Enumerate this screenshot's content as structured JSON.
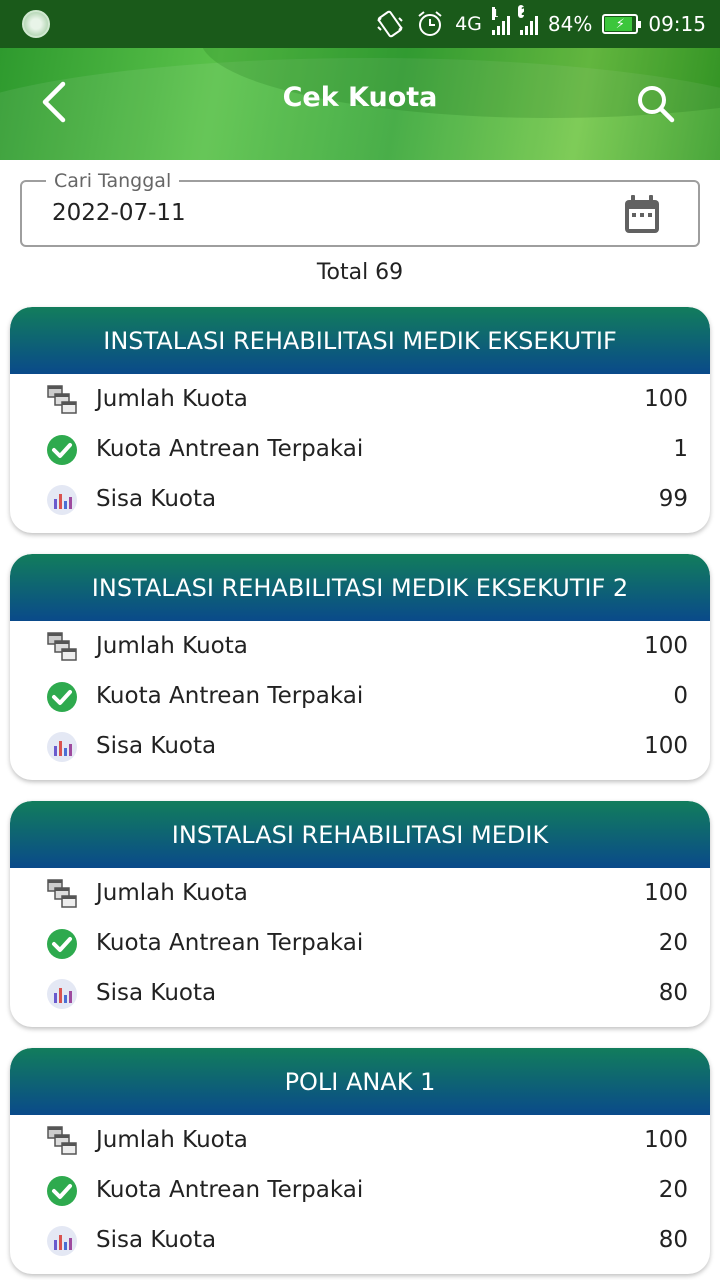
{
  "status": {
    "network": "4G",
    "sim1": "1",
    "sim2": "2",
    "battery": "84%",
    "time": "09:15"
  },
  "appbar": {
    "title": "Cek Kuota"
  },
  "date_field": {
    "label": "Cari Tanggal",
    "value": "2022-07-11"
  },
  "total": "Total 69",
  "cards": [
    {
      "title": "INSTALASI REHABILITASI MEDIK EKSEKUTIF",
      "rows": [
        {
          "label": "Jumlah Kuota",
          "value": "100"
        },
        {
          "label": "Kuota Antrean Terpakai",
          "value": "1"
        },
        {
          "label": "Sisa Kuota",
          "value": "99"
        }
      ]
    },
    {
      "title": "INSTALASI REHABILITASI MEDIK EKSEKUTIF 2",
      "rows": [
        {
          "label": "Jumlah Kuota",
          "value": "100"
        },
        {
          "label": "Kuota Antrean Terpakai",
          "value": "0"
        },
        {
          "label": "Sisa Kuota",
          "value": "100"
        }
      ]
    },
    {
      "title": "INSTALASI REHABILITASI MEDIK",
      "rows": [
        {
          "label": "Jumlah Kuota",
          "value": "100"
        },
        {
          "label": "Kuota Antrean Terpakai",
          "value": "20"
        },
        {
          "label": "Sisa Kuota",
          "value": "80"
        }
      ]
    },
    {
      "title": "POLI ANAK 1",
      "rows": [
        {
          "label": "Jumlah Kuota",
          "value": "100"
        },
        {
          "label": "Kuota Antrean Terpakai",
          "value": "20"
        },
        {
          "label": "Sisa Kuota",
          "value": "80"
        }
      ]
    }
  ],
  "colors": {
    "header_gradient_top": "#127d5c",
    "header_gradient_bottom": "#0a4a8a",
    "appbar_green": "#4caf50",
    "check_green": "#2eaa4e"
  },
  "icons": {
    "quota_total": "windows-stack-icon",
    "quota_used": "check-circle-icon",
    "quota_remaining": "bar-chart-icon"
  }
}
